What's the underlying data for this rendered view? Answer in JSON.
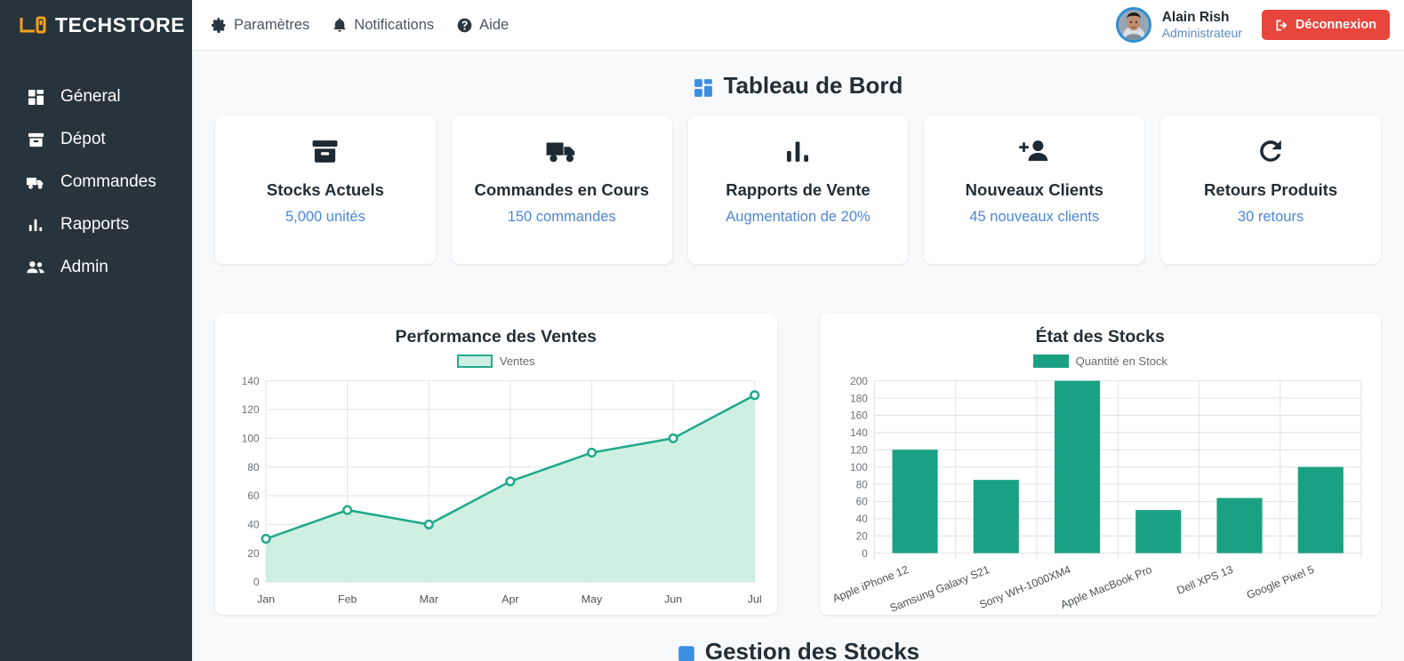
{
  "brand": {
    "name": "TECHSTORE",
    "logo_icon": "device-logo-icon",
    "accent": "#f5a11e"
  },
  "sidebar": {
    "background": "#27343b",
    "items": [
      {
        "label": "Géneral",
        "icon": "dashboard-grid-icon"
      },
      {
        "label": "Dépot",
        "icon": "archive-box-icon"
      },
      {
        "label": "Commandes",
        "icon": "truck-icon"
      },
      {
        "label": "Rapports",
        "icon": "bar-chart-icon"
      },
      {
        "label": "Admin",
        "icon": "users-icon"
      }
    ]
  },
  "topbar": {
    "links": [
      {
        "label": "Paramètres",
        "icon": "gear-icon"
      },
      {
        "label": "Notifications",
        "icon": "bell-icon"
      },
      {
        "label": "Aide",
        "icon": "question-circle-icon"
      }
    ],
    "user": {
      "name": "Alain Rish",
      "role": "Administrateur",
      "avatar_icon": "user-avatar"
    },
    "logout": {
      "label": "Déconnexion",
      "icon": "logout-icon",
      "color": "#e8453c"
    }
  },
  "page": {
    "title": "Tableau de Bord",
    "title_icon": "dashboard-grid-icon",
    "title_icon_color": "#3b8ee0"
  },
  "stat_cards": [
    {
      "icon": "archive-box-icon",
      "title": "Stocks Actuels",
      "value": "5,000 unités"
    },
    {
      "icon": "truck-icon",
      "title": "Commandes en Cours",
      "value": "150 commandes"
    },
    {
      "icon": "bar-chart-icon",
      "title": "Rapports de Vente",
      "value": "Augmentation de 20%"
    },
    {
      "icon": "user-plus-icon",
      "title": "Nouveaux Clients",
      "value": "45 nouveaux clients"
    },
    {
      "icon": "refresh-icon",
      "title": "Retours Produits",
      "value": "30 retours"
    }
  ],
  "footer_section": {
    "title": "Gestion des Stocks",
    "icon": "clipboard-icon"
  },
  "chart_data": [
    {
      "type": "area",
      "title": "Performance des Ventes",
      "categories": [
        "Jan",
        "Feb",
        "Mar",
        "Apr",
        "May",
        "Jun",
        "Jul"
      ],
      "series": [
        {
          "name": "Ventes",
          "values": [
            30,
            50,
            40,
            70,
            90,
            100,
            130
          ]
        }
      ],
      "legend": [
        "Ventes"
      ],
      "legend_position": "top",
      "ylim": [
        0,
        140
      ],
      "yticks": [
        0,
        20,
        40,
        60,
        80,
        100,
        120,
        140
      ],
      "xlabel": "",
      "ylabel": "",
      "grid": true,
      "line_color": "#20ab89",
      "fill_color": "#cdeee2"
    },
    {
      "type": "bar",
      "title": "État des Stocks",
      "categories": [
        "Apple iPhone 12",
        "Samsung Galaxy S21",
        "Sony WH-1000XM4",
        "Apple MacBook Pro",
        "Dell XPS 13",
        "Google Pixel 5"
      ],
      "series": [
        {
          "name": "Quantité en Stock",
          "values": [
            120,
            85,
            200,
            50,
            64,
            100
          ]
        }
      ],
      "legend": [
        "Quantité en Stock"
      ],
      "legend_position": "top",
      "ylim": [
        0,
        200
      ],
      "yticks": [
        0,
        20,
        40,
        60,
        80,
        100,
        120,
        140,
        160,
        180,
        200
      ],
      "xlabel": "",
      "ylabel": "",
      "grid": true,
      "bar_color": "#1aa183"
    }
  ]
}
